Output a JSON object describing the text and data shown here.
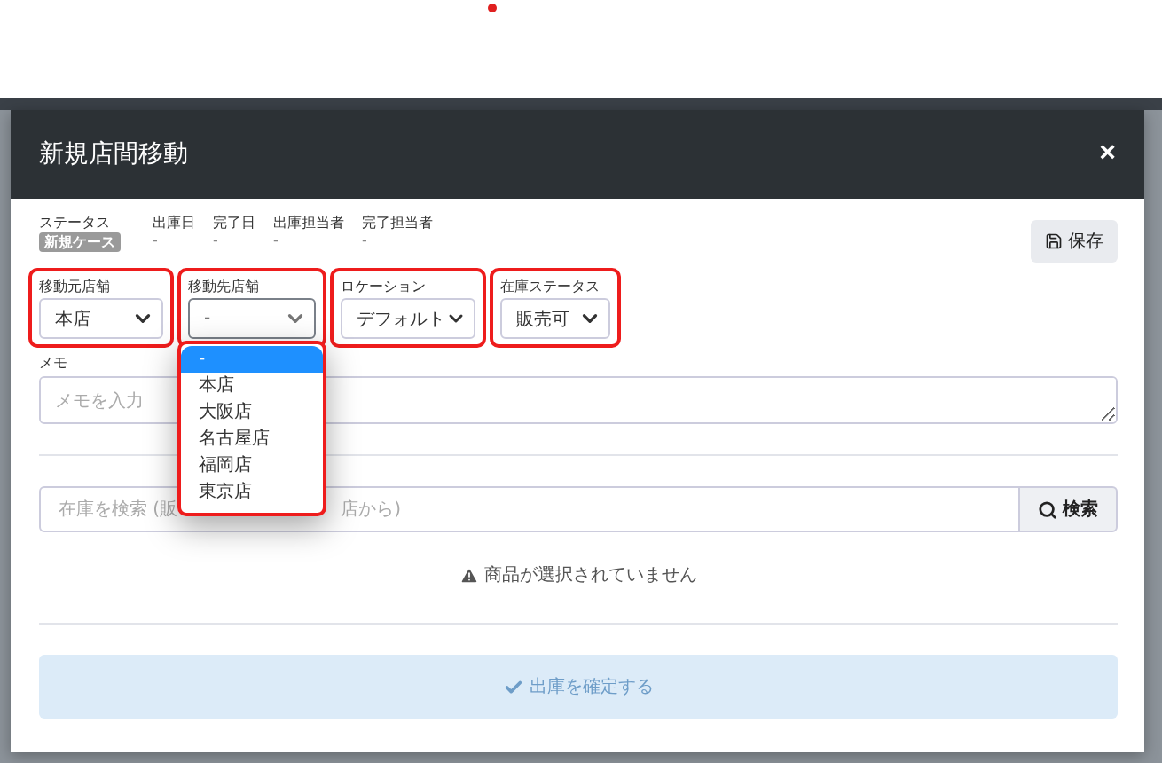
{
  "dialog": {
    "title": "新規店間移動",
    "close": "×"
  },
  "info": {
    "status_label": "ステータス",
    "status_badge": "新規ケース",
    "columns": [
      {
        "label": "出庫日",
        "value": "-"
      },
      {
        "label": "完了日",
        "value": "-"
      },
      {
        "label": "出庫担当者",
        "value": "-"
      },
      {
        "label": "完了担当者",
        "value": "-"
      }
    ]
  },
  "save_button": "保存",
  "fields": [
    {
      "label": "移動元店舗",
      "value": "本店",
      "highlighted": true,
      "open": false
    },
    {
      "label": "移動先店舗",
      "value": "-",
      "highlighted": true,
      "open": true,
      "options": [
        {
          "label": "-",
          "selected": true
        },
        {
          "label": "本店",
          "selected": false
        },
        {
          "label": "大阪店",
          "selected": false
        },
        {
          "label": "名古屋店",
          "selected": false
        },
        {
          "label": "福岡店",
          "selected": false
        },
        {
          "label": "東京店",
          "selected": false
        }
      ]
    },
    {
      "label": "ロケーション",
      "value": "デフォルト",
      "highlighted": true,
      "open": false
    },
    {
      "label": "在庫ステータス",
      "value": "販売可",
      "highlighted": true,
      "open": false
    }
  ],
  "memo": {
    "label": "メモ",
    "placeholder": "メモを入力"
  },
  "search": {
    "placeholder_parts": [
      "在庫を検索 (販",
      "店から)"
    ],
    "button": "検索"
  },
  "empty_message": "商品が選択されていません",
  "confirm_button": {
    "label": "出庫を確定する",
    "disabled": true
  }
}
